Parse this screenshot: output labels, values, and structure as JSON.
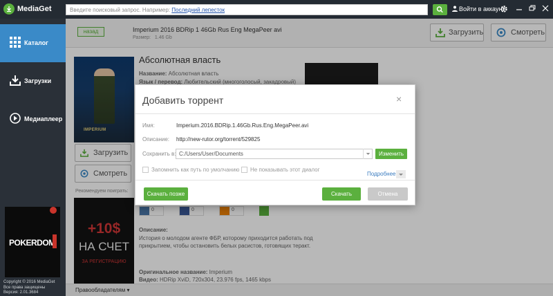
{
  "app": {
    "name": "MediaGet"
  },
  "search": {
    "placeholder_text": "Введите поисковый запрос. Например:",
    "example_link": "Последний лепесток"
  },
  "header": {
    "login": "Войти в аккаунт"
  },
  "sidebar": {
    "items": [
      {
        "label": "Каталог",
        "icon": "grid-icon",
        "active": true
      },
      {
        "label": "Загрузки",
        "icon": "download-icon",
        "active": false
      },
      {
        "label": "Медиаплеер",
        "icon": "play-icon",
        "active": false
      }
    ],
    "ad": {
      "brand": "POKERDOM"
    },
    "copyright": [
      "Copyright © 2016 MediaGet",
      "Все права защищены",
      "Версия: 2.01.3684"
    ]
  },
  "topbar": {
    "back": "назад",
    "file_title": "Imperium 2016 BDRip 1 46Gb Rus Eng MegaPeer avi",
    "size_label": "Размер:",
    "size_value": "1.46 Gb",
    "download": "Загрузить",
    "watch": "Смотреть"
  },
  "film": {
    "title": "Абсолютная власть",
    "name_key": "Название:",
    "name_value": "Абсолютная власть",
    "lang_key": "Язык / перевод:",
    "lang_value": "Любительский (многоголосый, закадровый)",
    "poster_title": "IMPERIUM",
    "download": "Загрузить",
    "watch": "Смотреть",
    "recommend": "Рекомендуем поиграть:",
    "social_counts": [
      "0",
      "0",
      "0"
    ],
    "desc_label": "Описание:",
    "description": "История о молодом агенте ФБР, которому приходится работать под прикрытием, чтобы остановить белых расистов, готовящих теракт.",
    "orig_key": "Оригинальное название:",
    "orig_value": "Imperium",
    "video_key": "Видео:",
    "video_value": "HDRip XviD, 720x304, 23.976 fps, 1465 kbps"
  },
  "promo": {
    "big": "+10$",
    "sub": "НА СЧЕТ",
    "small": "ЗА РЕГИСТРАЦИЮ"
  },
  "footer": {
    "rights": "Правообладателям"
  },
  "dialog": {
    "title": "Добавить торрент",
    "close": "×",
    "name_label": "Имя:",
    "name_value": "Imperium.2016.BDRip.1.46Gb.Rus.Eng.MegaPeer.avi",
    "desc_label": "Описание:",
    "desc_value": "http://new-rutor.org/torrent/529825",
    "save_label": "Сохранить в:",
    "save_path": "C:/Users/User/Documents",
    "change": "Изменить",
    "remember": "Запомнить как путь по умолчанию",
    "dont_show": "Не показывать этот диалог",
    "more": "Подробнее",
    "later": "Скачать позже",
    "download": "Скачать",
    "cancel": "Отмена"
  },
  "colors": {
    "accent_green": "#5bb03e",
    "sidebar_bg": "#2a3038",
    "active_nav": "#3a8ac8",
    "vk": "#4a76a8",
    "fb": "#3b5998",
    "ok": "#ee8208"
  }
}
